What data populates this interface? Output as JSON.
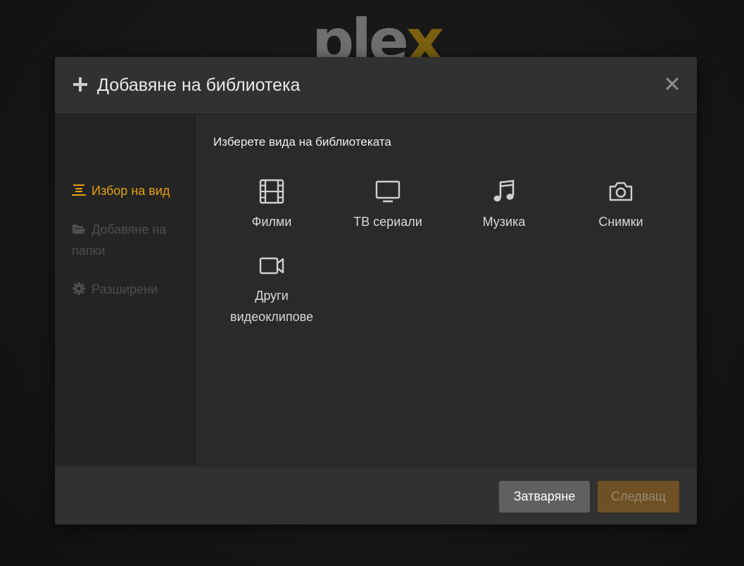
{
  "brand": {
    "logo_text_main": "ple",
    "logo_text_accent": "x"
  },
  "dialog": {
    "title": "Добавяне на библиотека",
    "close_icon": "close-icon"
  },
  "sidebar": {
    "items": [
      {
        "label": "Избор на вид",
        "icon": "list-icon",
        "active": true
      },
      {
        "label": "Добавяне на папки",
        "icon": "folder-open-icon",
        "active": false
      },
      {
        "label": "Разширени",
        "icon": "gear-icon",
        "active": false
      }
    ]
  },
  "main": {
    "heading": "Изберете вида на библиотеката",
    "types": [
      {
        "label": "Филми",
        "icon": "film-icon"
      },
      {
        "label": "ТВ сериали",
        "icon": "tv-icon"
      },
      {
        "label": "Музика",
        "icon": "music-note-icon"
      },
      {
        "label": "Снимки",
        "icon": "camera-icon"
      },
      {
        "label": "Други видеоклипове",
        "icon": "video-camera-icon"
      }
    ]
  },
  "footer": {
    "close_label": "Затваряне",
    "next_label": "Следващ"
  },
  "colors": {
    "accent": "#e5a00d",
    "background": "#2b2b2b",
    "disabled_button": "#6e5024"
  }
}
